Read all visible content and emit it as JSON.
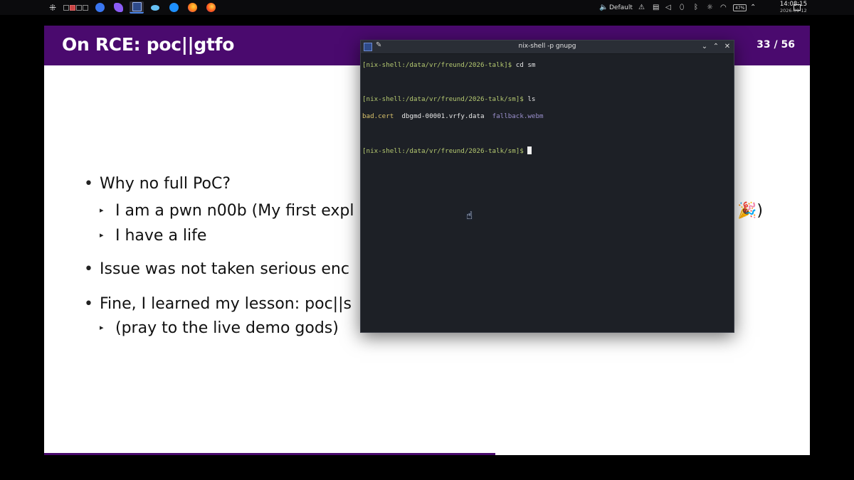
{
  "panel": {
    "launcher_icon": "app-launcher-icon",
    "pager": {
      "desktops": 4,
      "active": 1
    },
    "tasks": [
      {
        "name": "signal-icon",
        "color": "#3a76f0"
      },
      {
        "name": "obsidian-icon",
        "color": "#8b5cf6"
      },
      {
        "name": "presentation-icon",
        "color": "#2e4a8a",
        "active": true
      },
      {
        "name": "steam-icon",
        "color": "#66c0f4"
      },
      {
        "name": "browser-icon",
        "color": "#1e90ff"
      },
      {
        "name": "firefox-icon",
        "color": "#ff7a1a"
      },
      {
        "name": "firefox-dev-icon",
        "color": "#ff5a1a"
      }
    ],
    "audio_profile": "Default",
    "battery": "47%",
    "time": "14:08:15",
    "date": "2026-09-12"
  },
  "slide": {
    "title": "On RCE: poc||gtfo",
    "page": "33 / 56",
    "progress_fraction": 0.589,
    "bullets": [
      {
        "text": "Why no full PoC?",
        "level": 1
      },
      {
        "text": "I am a pwn n00b (My first expl",
        "level": 2,
        "tail": "🎉)"
      },
      {
        "text": "I have a life",
        "level": 2
      },
      {
        "text": "Issue was not taken serious enc",
        "level": 1
      },
      {
        "text": "Fine, I learned my lesson: poc||s",
        "level": 1
      },
      {
        "text": "(pray to the live demo gods)",
        "level": 2
      }
    ]
  },
  "terminal": {
    "title": "nix-shell -p gnupg",
    "lines": [
      {
        "prompt": "[nix-shell:/data/vr/freund/2026-talk]$",
        "cmd": " cd sm"
      },
      {
        "prompt": "[nix-shell:/data/vr/freund/2026-talk/sm]$",
        "cmd": " ls"
      },
      {
        "prompt": "[nix-shell:/data/vr/freund/2026-talk/sm]$",
        "cmd": " "
      }
    ],
    "ls_output": {
      "cert": "bad.cert",
      "data": "dbgmd-00001.vrfy.data",
      "webm": "fallback.webm"
    },
    "buttons": {
      "minimize": "⌄",
      "maximize": "⌃",
      "close": "✕"
    }
  }
}
